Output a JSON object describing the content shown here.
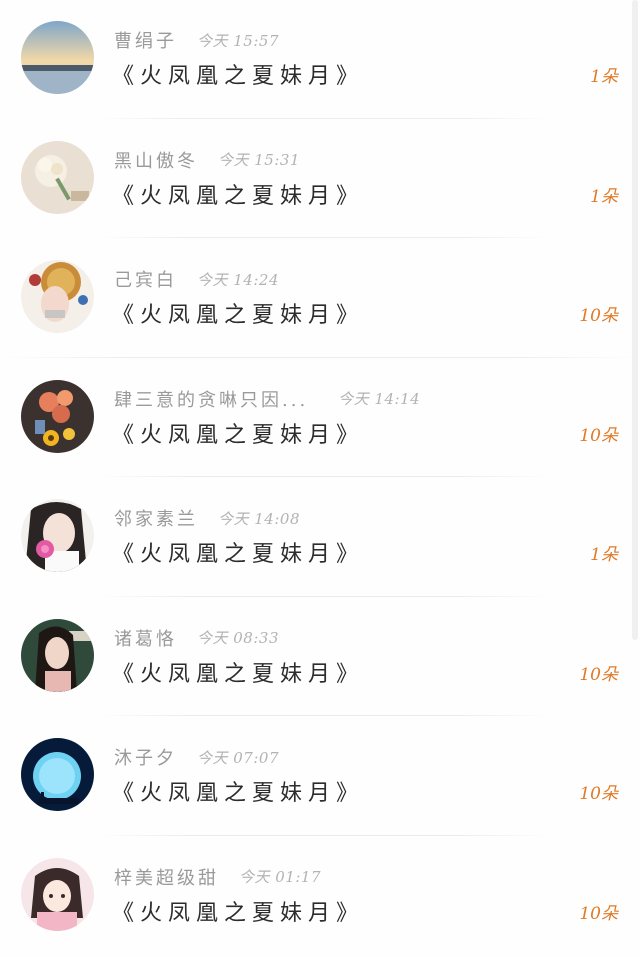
{
  "rows": [
    {
      "name": "曹绢子",
      "time": "今天 15:57",
      "title": "《火凤凰之夏妹月》",
      "count": "1朵",
      "avatar_icon": "landscape-avatar-icon"
    },
    {
      "name": "黑山傲冬",
      "time": "今天 15:31",
      "title": "《火凤凰之夏妹月》",
      "count": "1朵",
      "avatar_icon": "flower-avatar-icon"
    },
    {
      "name": "己宾白",
      "time": "今天 14:24",
      "title": "《火凤凰之夏妹月》",
      "count": "10朵",
      "avatar_icon": "opera-avatar-icon"
    },
    {
      "name": "肆三意的贪啉只因...",
      "time": "今天 14:14",
      "title": "《火凤凰之夏妹月》",
      "count": "10朵",
      "avatar_icon": "sunflower-avatar-icon"
    },
    {
      "name": "邻家素兰",
      "time": "今天 14:08",
      "title": "《火凤凰之夏妹月》",
      "count": "1朵",
      "avatar_icon": "girl-flower-avatar-icon"
    },
    {
      "name": "诸葛恪",
      "time": "今天 08:33",
      "title": "《火凤凰之夏妹月》",
      "count": "10朵",
      "avatar_icon": "woman-portrait-avatar-icon"
    },
    {
      "name": "沐子夕",
      "time": "今天 07:07",
      "title": "《火凤凰之夏妹月》",
      "count": "10朵",
      "avatar_icon": "moon-avatar-icon"
    },
    {
      "name": "梓美超级甜",
      "time": "今天 01:17",
      "title": "《火凤凰之夏妹月》",
      "count": "10朵",
      "avatar_icon": "anime-girl-avatar-icon"
    }
  ],
  "colors": {
    "count": "#e07a26",
    "title": "#2c2c2c",
    "meta": "#a6a6a6"
  }
}
